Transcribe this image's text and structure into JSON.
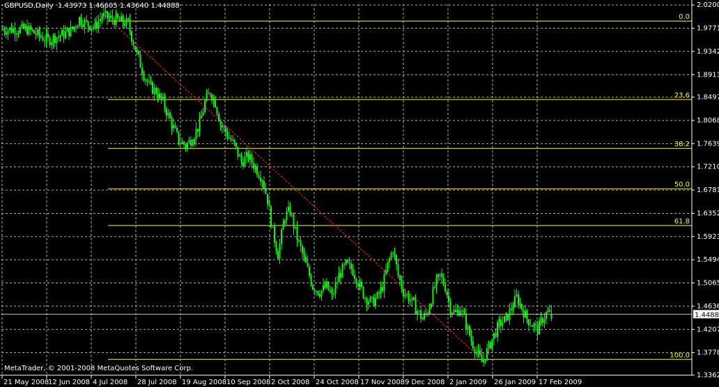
{
  "window": {
    "title": "GBPUSD,Daily  1.43973 1.46605 1.43640 1.44888",
    "copyright": "MetaTrader, © 2001-2008 MetaQuotes Software Corp."
  },
  "chart_data": {
    "type": "candlestick",
    "symbol": "GBPUSD",
    "timeframe": "Daily",
    "ohlc": {
      "open": 1.43973,
      "high": 1.46605,
      "low": 1.4364,
      "close": 1.44888
    },
    "current_price": 1.44888,
    "ylim": [
      1.3362,
      2.0215
    ],
    "y_ticks": [
      "2.02000",
      "1.97710",
      "1.93420",
      "1.89130",
      "1.84970",
      "1.80680",
      "1.76390",
      "1.72100",
      "1.67810",
      "1.63520",
      "1.59230",
      "1.54940",
      "1.50650",
      "1.46360",
      "1.42070",
      "1.37780",
      "1.33620"
    ],
    "x_ticks": [
      "21 May 2008",
      "12 Jun 2008",
      "4 Jul 2008",
      "28 Jul 2008",
      "19 Aug 2008",
      "10 Sep 2008",
      "2 Oct 2008",
      "24 Oct 2008",
      "17 Nov 2008",
      "9 Dec 2008",
      "2 Jan 2009",
      "26 Jan 2009",
      "17 Feb 2009"
    ],
    "fibonacci": {
      "high": 1.9904,
      "low": 1.3654,
      "levels": [
        {
          "label": "0.0",
          "value": 1.9904
        },
        {
          "label": "23.6",
          "value": 1.8454
        },
        {
          "label": "38.2",
          "value": 1.7551
        },
        {
          "label": "50.0",
          "value": 1.6805
        },
        {
          "label": "61.8",
          "value": 1.6127
        },
        {
          "label": "100.0",
          "value": 1.3654
        }
      ]
    },
    "path": [
      [
        0,
        1.975
      ],
      [
        14,
        1.975
      ],
      [
        26,
        1.955
      ],
      [
        36,
        1.968
      ],
      [
        40,
        1.975
      ],
      [
        44,
        1.995
      ],
      [
        48,
        1.985
      ],
      [
        53,
        1.98
      ],
      [
        57,
        2.0
      ],
      [
        62,
        1.995
      ],
      [
        68,
        1.99
      ],
      [
        72,
        1.985
      ],
      [
        75,
        1.95
      ],
      [
        80,
        1.9
      ],
      [
        84,
        1.87
      ],
      [
        88,
        1.86
      ],
      [
        92,
        1.84
      ],
      [
        97,
        1.8
      ],
      [
        101,
        1.77
      ],
      [
        105,
        1.76
      ],
      [
        109,
        1.775
      ],
      [
        113,
        1.8
      ],
      [
        116,
        1.84
      ],
      [
        119,
        1.86
      ],
      [
        122,
        1.84
      ],
      [
        125,
        1.8
      ],
      [
        129,
        1.78
      ],
      [
        133,
        1.76
      ],
      [
        137,
        1.73
      ],
      [
        141,
        1.74
      ],
      [
        145,
        1.72
      ],
      [
        149,
        1.7
      ],
      [
        152,
        1.66
      ],
      [
        155,
        1.6
      ],
      [
        158,
        1.56
      ],
      [
        162,
        1.63
      ],
      [
        165,
        1.64
      ],
      [
        168,
        1.6
      ],
      [
        172,
        1.56
      ],
      [
        175,
        1.53
      ],
      [
        178,
        1.5
      ],
      [
        182,
        1.49
      ],
      [
        186,
        1.5
      ],
      [
        189,
        1.48
      ],
      [
        193,
        1.52
      ],
      [
        197,
        1.54
      ],
      [
        201,
        1.53
      ],
      [
        205,
        1.5
      ],
      [
        208,
        1.48
      ],
      [
        212,
        1.47
      ],
      [
        215,
        1.48
      ],
      [
        218,
        1.5
      ],
      [
        221,
        1.54
      ],
      [
        224,
        1.57
      ],
      [
        227,
        1.52
      ],
      [
        230,
        1.49
      ],
      [
        233,
        1.48
      ],
      [
        237,
        1.46
      ],
      [
        241,
        1.44
      ],
      [
        244,
        1.455
      ],
      [
        248,
        1.5
      ],
      [
        251,
        1.52
      ],
      [
        254,
        1.5
      ],
      [
        257,
        1.46
      ],
      [
        260,
        1.45
      ],
      [
        263,
        1.46
      ],
      [
        266,
        1.43
      ],
      [
        269,
        1.4
      ],
      [
        272,
        1.38
      ],
      [
        275,
        1.36
      ],
      [
        278,
        1.38
      ],
      [
        282,
        1.41
      ],
      [
        285,
        1.43
      ],
      [
        289,
        1.44
      ],
      [
        292,
        1.46
      ],
      [
        295,
        1.48
      ],
      [
        298,
        1.46
      ],
      [
        301,
        1.44
      ],
      [
        304,
        1.43
      ],
      [
        307,
        1.42
      ],
      [
        310,
        1.44
      ],
      [
        312,
        1.45
      ]
    ]
  }
}
